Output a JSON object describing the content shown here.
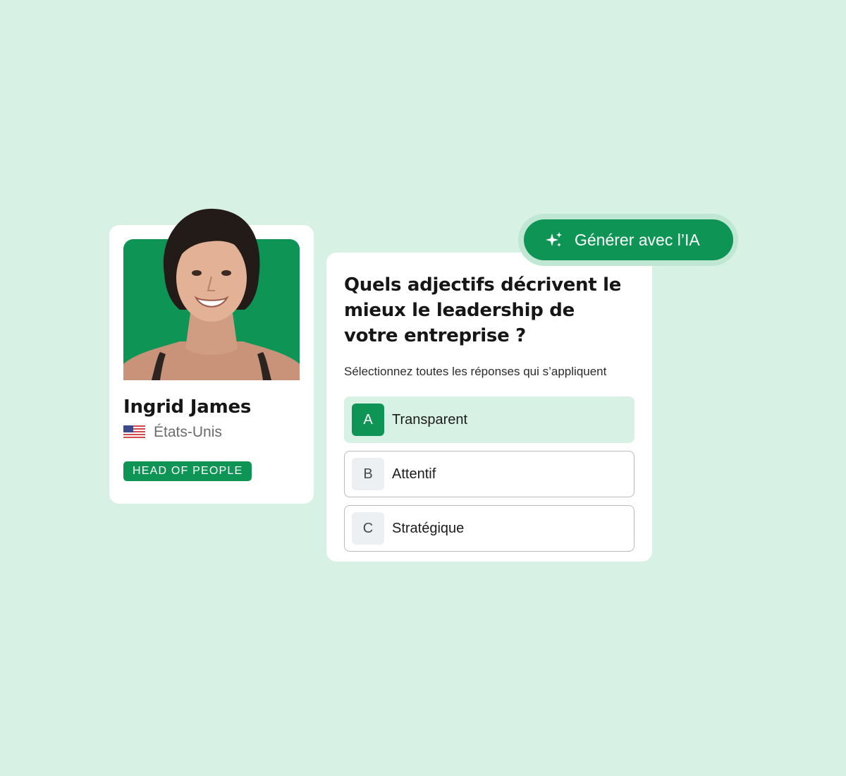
{
  "profile": {
    "name": "Ingrid James",
    "country": "États-Unis",
    "role": "HEAD OF PEOPLE",
    "flag_icon": "us-flag-icon"
  },
  "ai_button": {
    "label": "Générer avec l’IA",
    "icon": "sparkles-icon"
  },
  "question": {
    "title": "Quels adjectifs décrivent le mieux le leadership de votre entreprise ?",
    "hint": "Sélectionnez toutes les réponses qui s’appliquent",
    "options": [
      {
        "letter": "A",
        "label": "Transparent",
        "selected": true
      },
      {
        "letter": "B",
        "label": "Attentif",
        "selected": false
      },
      {
        "letter": "C",
        "label": "Stratégique",
        "selected": false
      }
    ]
  },
  "colors": {
    "background": "#d8f1e5",
    "brand_green": "#0e9556",
    "card": "#ffffff",
    "selected_option": "#d8f1e5"
  }
}
